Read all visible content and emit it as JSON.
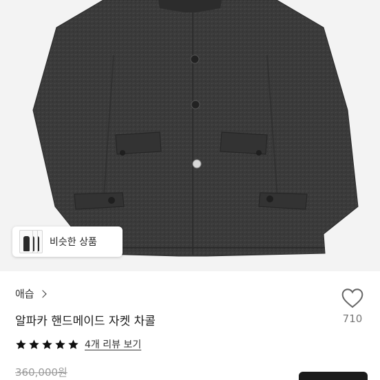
{
  "product_image": {
    "alt": "alpaca handmade jacket charcoal"
  },
  "similar_chip": {
    "label": "비슷한 상품"
  },
  "product": {
    "seller": "애습",
    "title": "알파카 핸드메이드 자켓 차콜",
    "rating_stars": 5,
    "review_link": "4개 리뷰 보기",
    "original_price": "360,000원"
  },
  "like": {
    "count": "710",
    "icon": "heart-outline-icon"
  },
  "colors": {
    "coat": "#3b3b3b",
    "hero_bg": "#f3f3f3",
    "star": "#111111",
    "button": "#1b1b1b"
  }
}
